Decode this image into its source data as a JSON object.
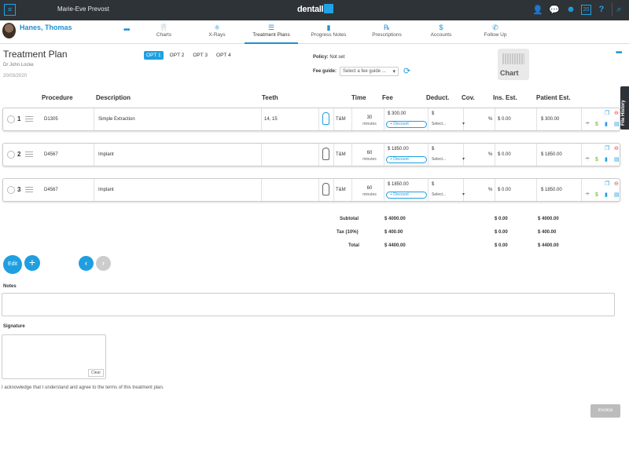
{
  "topbar": {
    "user_name": "Marie-Eve Prevost",
    "logo_text": "dentall",
    "icons": [
      "person-icon",
      "chat-icon",
      "patients-icon",
      "calendar-icon",
      "help-icon",
      "search-icon"
    ],
    "calendar_day": "20"
  },
  "patient": {
    "name": "Hanes, Thomas",
    "more": "•••"
  },
  "tabs": [
    {
      "label": "Charts",
      "icon": "tooth-icon",
      "glyph": "🦷"
    },
    {
      "label": "X-Rays",
      "icon": "xray-icon",
      "glyph": "⚛"
    },
    {
      "label": "Treatment Plans",
      "icon": "list-icon",
      "glyph": "☰",
      "active": true
    },
    {
      "label": "Progress Notes",
      "icon": "notes-icon",
      "glyph": "▮"
    },
    {
      "label": "Prescriptions",
      "icon": "rx-icon",
      "glyph": "℞"
    },
    {
      "label": "Accounts",
      "icon": "dollar-icon",
      "glyph": "$"
    },
    {
      "label": "Follow Up",
      "icon": "phone-icon",
      "glyph": "✆"
    }
  ],
  "plan": {
    "title": "Treatment Plan",
    "doctor": "Dr John Locke",
    "date": "20/03/2020",
    "options": [
      "OPT 1",
      "OPT 2",
      "OPT 3",
      "OPT 4"
    ],
    "active_option": "OPT 1",
    "policy_label": "Policy:",
    "policy_value": "Not set",
    "fee_guide_label": "Fee guide:",
    "fee_guide_placeholder": "Select a fee guide ...",
    "chart_label": "Chart",
    "more": "•••",
    "file_history": "File History"
  },
  "table": {
    "headers": {
      "procedure": "Procedure",
      "description": "Description",
      "teeth": "Teeth",
      "time": "Time",
      "fee": "Fee",
      "deduct": "Deduct.",
      "cov": "Cov.",
      "ins_est": "Ins. Est.",
      "patient_est": "Patient Est."
    },
    "rows": [
      {
        "num": "1",
        "procedure": "D1305",
        "description": "Simple Extraction",
        "teeth": "14, 15",
        "type": "T&M",
        "time": "30",
        "time_unit": "minutes",
        "fee": "$ 300.00",
        "discount": "+ Discount",
        "deduct": "$",
        "deduct_select": "Select...",
        "cov": "%",
        "ins_est": "$ 0.00",
        "patient_est": "$ 300.00"
      },
      {
        "num": "2",
        "procedure": "D4567",
        "description": "Implant",
        "teeth": "",
        "type": "T&M",
        "time": "60",
        "time_unit": "minutes",
        "fee": "$ 1850.00",
        "discount": "+ Discount",
        "deduct": "$",
        "deduct_select": "Select...",
        "cov": "%",
        "ins_est": "$ 0.00",
        "patient_est": "$ 1850.00"
      },
      {
        "num": "3",
        "procedure": "D4567",
        "description": "Implant",
        "teeth": "",
        "type": "T&M",
        "time": "60",
        "time_unit": "minutes",
        "fee": "$ 1850.00",
        "discount": "+ Discount",
        "deduct": "$",
        "deduct_select": "Select...",
        "cov": "%",
        "ins_est": "$ 0.00",
        "patient_est": "$ 1850.00"
      }
    ]
  },
  "totals": {
    "subtotal": {
      "label": "Subtotal",
      "fee": "$ 4000.00",
      "ins": "$ 0.00",
      "patient": "$ 4000.00"
    },
    "tax": {
      "label": "Tax (10%)",
      "fee": "$ 400.00",
      "ins": "$ 0.00",
      "patient": "$ 400.00"
    },
    "total": {
      "label": "Total",
      "fee": "$ 4400.00",
      "ins": "$ 0.00",
      "patient": "$ 4400.00"
    }
  },
  "buttons": {
    "edit": "Edit",
    "add": "+",
    "prev": "‹",
    "next": "›",
    "invoice": "Invoice",
    "clear": "Clear"
  },
  "notes_label": "Notes",
  "signature_label": "Signature",
  "acknowledgement": "I acknowledge that I understand and agree to the terms of this treatment plan.",
  "colors": {
    "accent": "#1f9fe0",
    "topbar": "#2e3338",
    "delete": "#e53935",
    "dollar": "#8bc34a"
  }
}
